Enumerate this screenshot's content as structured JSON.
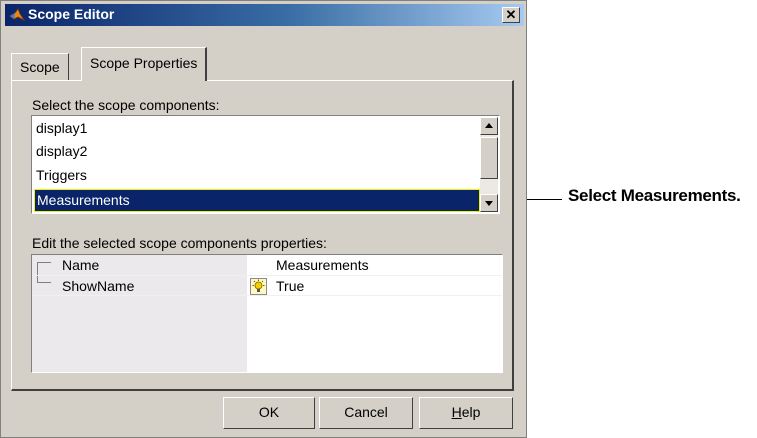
{
  "window": {
    "title": "Scope Editor",
    "close_glyph": "✕"
  },
  "tabs": [
    {
      "label": "Scope",
      "active": false
    },
    {
      "label": "Scope Properties",
      "active": true
    }
  ],
  "components": {
    "label": "Select the scope components:",
    "items": [
      "display1",
      "display2",
      "Triggers",
      "Measurements"
    ],
    "selected": "Measurements"
  },
  "properties": {
    "label": "Edit the selected scope components properties:",
    "rows": [
      {
        "name": "Name",
        "value": "Measurements",
        "icon": ""
      },
      {
        "name": "ShowName",
        "value": "True",
        "icon": "lightbulb-icon"
      }
    ]
  },
  "buttons": {
    "ok": "OK",
    "cancel": "Cancel",
    "help_prefix": "H",
    "help_rest": "elp"
  },
  "callout": "Select Measurements.",
  "colors": {
    "titlebar": "#0a246a",
    "selection": "#0a246a",
    "dialog_bg": "#d4d0c8"
  }
}
